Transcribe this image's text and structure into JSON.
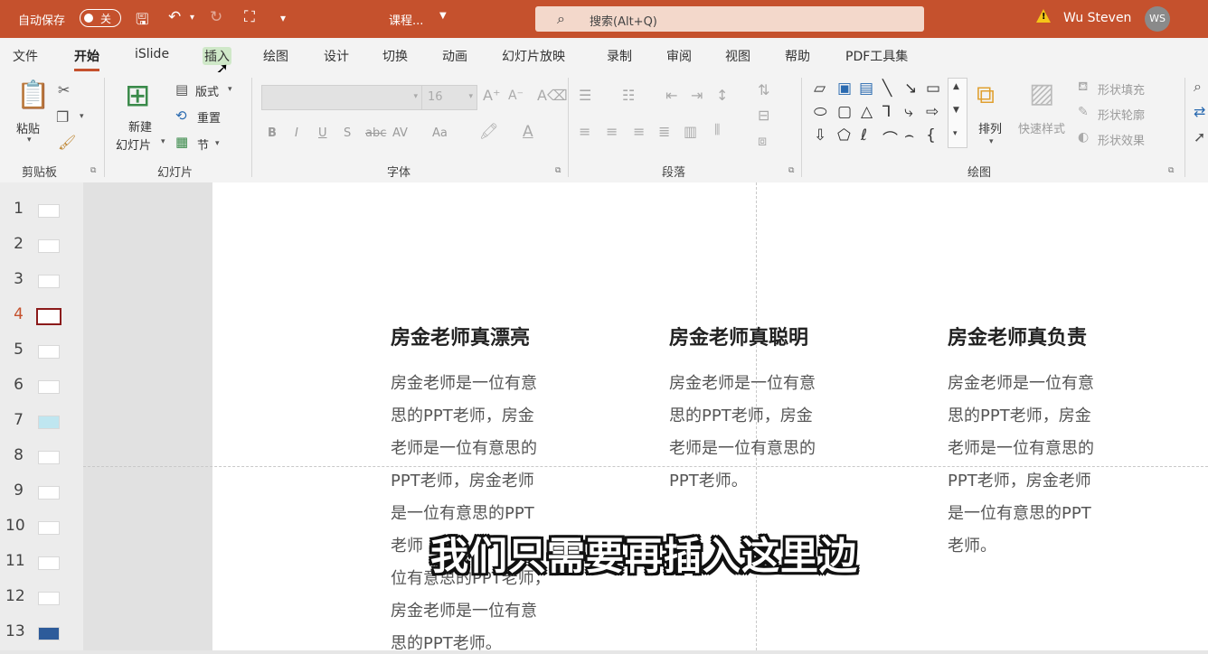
{
  "titlebar": {
    "autosave_label": "自动保存",
    "toggle_state": "关",
    "doc_title": "课程...",
    "search_placeholder": "搜索(Alt+Q)",
    "user_name": "Wu Steven",
    "user_initials": "WS",
    "accent_color": "#c5512d"
  },
  "tabs": [
    "文件",
    "开始",
    "iSlide",
    "插入",
    "绘图",
    "设计",
    "切换",
    "动画",
    "幻灯片放映",
    "录制",
    "审阅",
    "视图",
    "帮助",
    "PDF工具集"
  ],
  "active_tab": "开始",
  "hover_tab": "插入",
  "ribbon": {
    "clipboard": {
      "paste": "粘贴",
      "label": "剪贴板"
    },
    "slides": {
      "new_slide_line1": "新建",
      "new_slide_line2": "幻灯片",
      "layout": "版式",
      "reset": "重置",
      "section": "节",
      "label": "幻灯片"
    },
    "font": {
      "size": "16",
      "label": "字体",
      "bold": "B",
      "italic": "I",
      "underline": "U",
      "shadow": "S",
      "strike": "abc",
      "spacing": "AV",
      "case": "Aa"
    },
    "paragraph": {
      "label": "段落"
    },
    "drawing": {
      "arrange": "排列",
      "quick_styles": "快速样式",
      "shape_fill": "形状填充",
      "shape_outline": "形状轮廓",
      "shape_effects": "形状效果",
      "label": "绘图"
    }
  },
  "thumbnails": {
    "numbers": [
      "1",
      "2",
      "3",
      "4",
      "5",
      "6",
      "7",
      "8",
      "9",
      "10",
      "11",
      "12",
      "13"
    ],
    "current": "4"
  },
  "slide": {
    "columns": [
      {
        "title": "房金老师真漂亮",
        "lines": [
          "房金老师是一位有意",
          "思的PPT老师，房金",
          "老师是一位有意思的",
          "PPT老师，房金老师",
          "是一位有意思的PPT",
          "老师",
          "位有意思的PPT老师，",
          "房金老师是一位有意",
          "思的PPT老师。"
        ]
      },
      {
        "title": "房金老师真聪明",
        "lines": [
          "房金老师是一位有意",
          "思的PPT老师，房金",
          "老师是一位有意思的",
          "PPT老师。"
        ]
      },
      {
        "title": "房金老师真负责",
        "lines": [
          "房金老师是一位有意",
          "思的PPT老师，房金",
          "老师是一位有意思的",
          "PPT老师，房金老师",
          "是一位有意思的PPT",
          "老师。"
        ]
      }
    ]
  },
  "subtitle": "我们只需要再插入这里边"
}
